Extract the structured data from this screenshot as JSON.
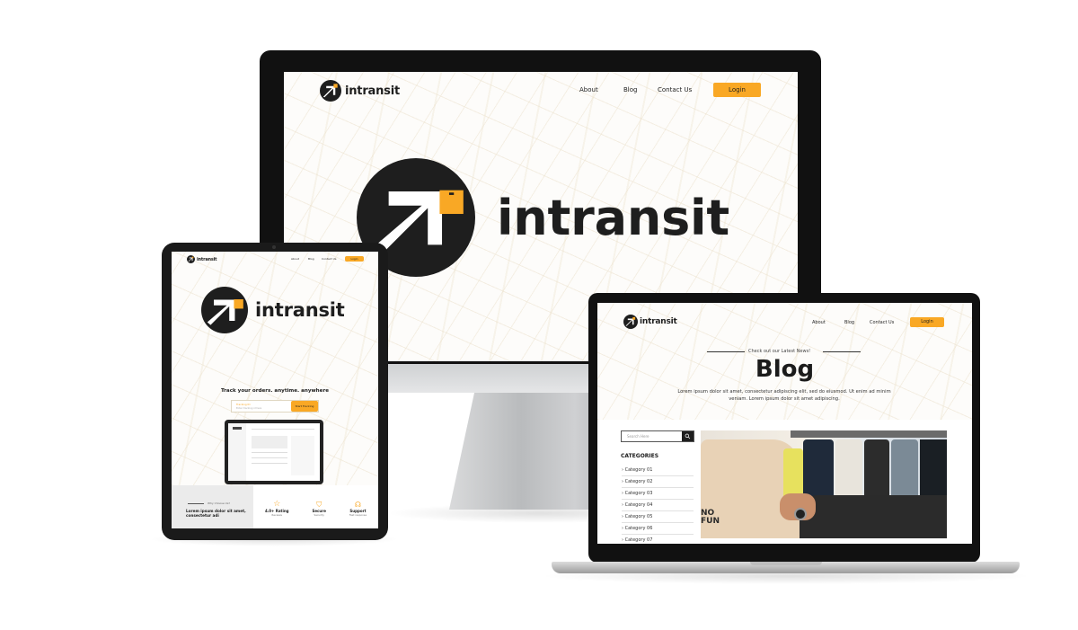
{
  "brand": {
    "name": "intransit",
    "accent": "#f9a825",
    "dark": "#1e1e1e"
  },
  "nav": {
    "about": "About",
    "blog": "Blog",
    "contact": "Contact Us",
    "login": "Login"
  },
  "tablet": {
    "tagline": "Track your orders. anytime. anywhere",
    "tracking_label": "Tracking ID",
    "tracking_placeholder": "Enter tracking id here",
    "track_button": "Start Tracking",
    "why_label": "Why Choose Us?",
    "why_text": "Lorem ipsum dolor sit amet, consectetur adi",
    "features": [
      {
        "title": "4.0+ Rating",
        "sub": "Reviews",
        "icon": "star-icon"
      },
      {
        "title": "Secure",
        "sub": "Security",
        "icon": "shield-icon"
      },
      {
        "title": "Support",
        "sub": "Fast response",
        "icon": "headset-icon"
      }
    ]
  },
  "blog": {
    "eyebrow": "Check out our Latest News!",
    "title": "Blog",
    "intro": "Lorem ipsum dolor sit amet, consectetur adipiscing elit, sed do eiusmod. Ut enim ad minim veniam. Lorem ipsum dolor sit amet adipiscing.",
    "search_placeholder": "Search Here",
    "categories_heading": "CATEGORIES",
    "categories": [
      "Category 01",
      "Category 02",
      "Category 03",
      "Category 04",
      "Category 05",
      "Category 06",
      "Category 07"
    ],
    "shirt_print": "NO\nFUN"
  }
}
